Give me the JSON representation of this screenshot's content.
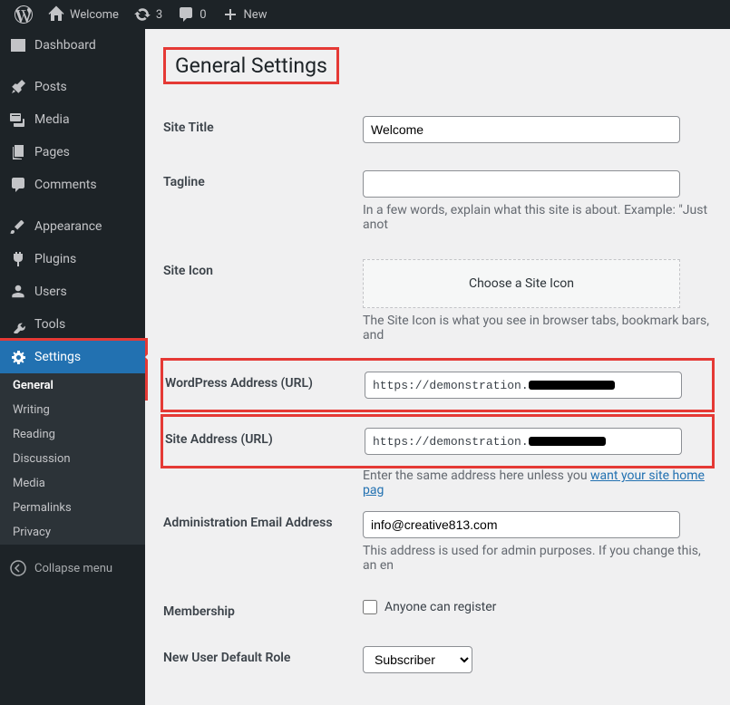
{
  "toolbar": {
    "site_name": "Welcome",
    "updates_count": "3",
    "comments_count": "0",
    "new_label": "New"
  },
  "sidebar": {
    "dashboard": "Dashboard",
    "posts": "Posts",
    "media": "Media",
    "pages": "Pages",
    "comments": "Comments",
    "appearance": "Appearance",
    "plugins": "Plugins",
    "users": "Users",
    "tools": "Tools",
    "settings": "Settings",
    "collapse": "Collapse menu"
  },
  "submenu": {
    "general": "General",
    "writing": "Writing",
    "reading": "Reading",
    "discussion": "Discussion",
    "media": "Media",
    "permalinks": "Permalinks",
    "privacy": "Privacy"
  },
  "page": {
    "title": "General Settings"
  },
  "fields": {
    "site_title_label": "Site Title",
    "site_title_value": "Welcome",
    "tagline_label": "Tagline",
    "tagline_value": "",
    "tagline_desc": "In a few words, explain what this site is about. Example: \"Just anot",
    "site_icon_label": "Site Icon",
    "site_icon_button": "Choose a Site Icon",
    "site_icon_desc": "The Site Icon is what you see in browser tabs, bookmark bars, and",
    "wp_url_label": "WordPress Address (URL)",
    "wp_url_value": "https://demonstration.",
    "site_url_label": "Site Address (URL)",
    "site_url_value": "https://demonstration.",
    "site_url_desc": "Enter the same address here unless you ",
    "site_url_link": "want your site home pag",
    "admin_email_label": "Administration Email Address",
    "admin_email_value": "info@creative813.com",
    "admin_email_desc": "This address is used for admin purposes. If you change this, an en",
    "membership_label": "Membership",
    "membership_check": "Anyone can register",
    "role_label": "New User Default Role",
    "role_value": "Subscriber"
  }
}
